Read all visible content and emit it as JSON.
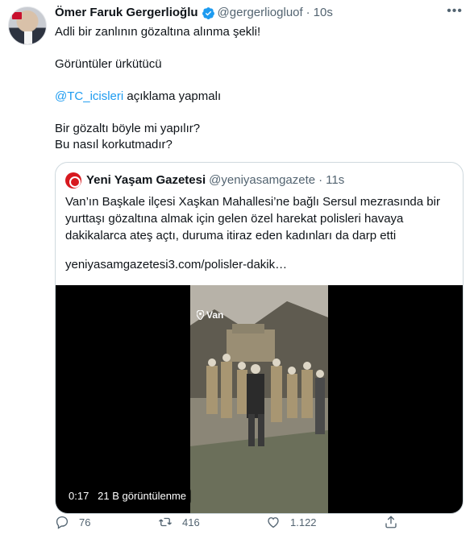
{
  "author": {
    "name": "Ömer Faruk Gergerlioğlu",
    "handle": "@gergerliogluof",
    "time": "10s",
    "verified_icon": "verified-badge-icon"
  },
  "tweet": {
    "line1": "Adli bir zanlının gözaltına alınma şekli!",
    "line2": "Görüntüler ürkütücü",
    "mention": "@TC_icisleri",
    "mention_rest": " açıklama yapmalı",
    "line4a": "Bir gözaltı böyle mi yapılır?",
    "line4b": "Bu nasıl korkutmadır?"
  },
  "quote": {
    "name": "Yeni Yaşam Gazetesi",
    "handle": "@yeniyasamgazete",
    "time": "11s",
    "text": "Van’ın Başkale ilçesi Xaşkan Mahallesi’ne bağlı Sersul mezrasında bir yurttaşı gözaltına almak için gelen özel harekat polisleri havaya dakikalarca ateş açtı, duruma itiraz eden kadınları da darp etti",
    "link": "yeniyasamgazetesi3.com/polisler-dakik…",
    "video": {
      "location_tag": "Van",
      "duration": "0:17",
      "views": "21 B görüntülenme"
    }
  },
  "actions": {
    "replies": "76",
    "retweets": "416",
    "likes": "1.122"
  },
  "colors": {
    "accent": "#1d9bf0",
    "muted": "#536471",
    "text": "#0f1419",
    "border": "#cfd9de"
  }
}
